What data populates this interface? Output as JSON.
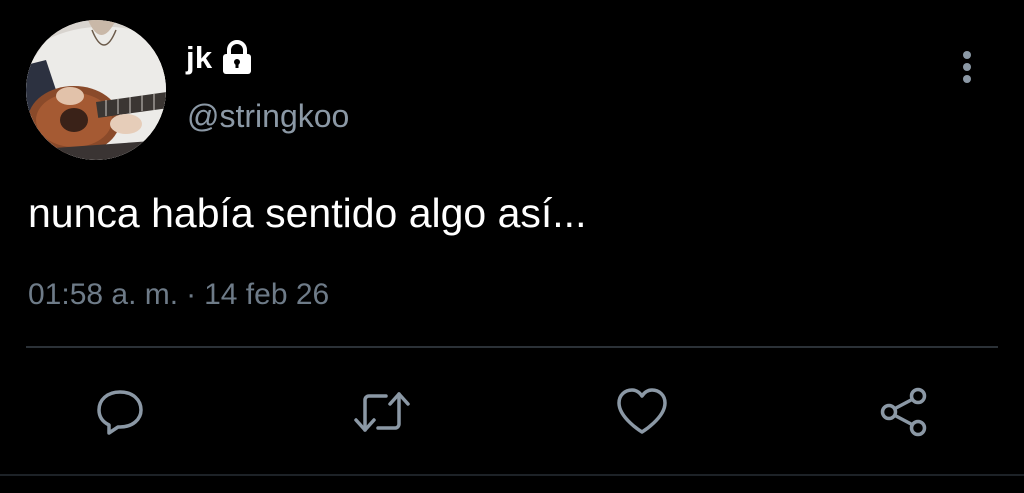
{
  "user": {
    "display_name": "jk",
    "handle": "@stringkoo",
    "avatar_icon": "avatar-guitar-photo",
    "protected_icon": "lock-icon"
  },
  "tweet": {
    "text": "nunca había sentido algo así...",
    "time": "01:58 a. m.",
    "separator": "·",
    "date": "14 feb 26"
  },
  "actions": [
    {
      "name": "reply",
      "icon": "speech-bubble-icon"
    },
    {
      "name": "retweet",
      "icon": "retweet-arrows-icon"
    },
    {
      "name": "like",
      "icon": "heart-icon"
    },
    {
      "name": "share",
      "icon": "share-nodes-icon"
    }
  ],
  "menu": {
    "icon": "more-vertical-icon"
  },
  "colors": {
    "background": "#000000",
    "primary_text": "#ffffff",
    "secondary_text": "#8b98a5",
    "meta_text": "#6e7b88",
    "divider": "#2b3137",
    "icon": "#8b98a5"
  }
}
